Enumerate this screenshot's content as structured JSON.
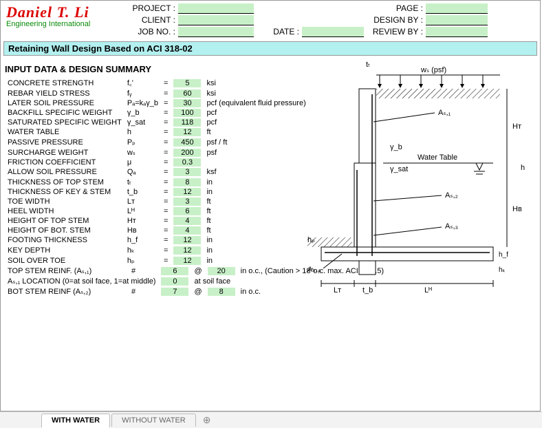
{
  "logo": {
    "name": "Daniel T. Li",
    "sub": "Engineering International"
  },
  "header": {
    "project_l": "PROJECT :",
    "client_l": "CLIENT :",
    "jobno_l": "JOB NO. :",
    "date_l": "DATE :",
    "page_l": "PAGE :",
    "design_l": "DESIGN BY :",
    "review_l": "REVIEW BY :"
  },
  "title": "Retaining Wall Design Based on ACI 318-02",
  "section": "INPUT DATA & DESIGN SUMMARY",
  "rows": [
    {
      "l": "CONCRETE STRENGTH",
      "s": "f꜀'",
      "v": "5",
      "u": "ksi"
    },
    {
      "l": "REBAR YIELD STRESS",
      "s": "fᵧ",
      "v": "60",
      "u": "ksi"
    },
    {
      "l": "LATER SOIL PRESSURE",
      "s": "Pₐ=kₐγ_b",
      "v": "30",
      "u": "pcf (equivalent fluid pressure)"
    },
    {
      "l": "BACKFILL SPECIFIC WEIGHT",
      "s": "γ_b",
      "v": "100",
      "u": "pcf"
    },
    {
      "l": "SATURATED SPECIFIC WEIGHT",
      "s": "γ_sat",
      "v": "118",
      "u": "pcf"
    },
    {
      "l": "WATER TABLE",
      "s": "h",
      "v": "12",
      "u": "ft"
    },
    {
      "l": "PASSIVE PRESSURE",
      "s": "Pₚ",
      "v": "450",
      "u": "psf / ft"
    },
    {
      "l": "SURCHARGE WEIGHT",
      "s": "wₛ",
      "v": "200",
      "u": "psf"
    },
    {
      "l": "FRICTION COEFFICIENT",
      "s": "μ",
      "v": "0.3",
      "u": ""
    },
    {
      "l": "ALLOW SOIL PRESSURE",
      "s": "Qₐ",
      "v": "3",
      "u": "ksf"
    },
    {
      "l": "THICKNESS OF TOP STEM",
      "s": "tₜ",
      "v": "8",
      "u": "in"
    },
    {
      "l": "THICKNESS OF KEY & STEM",
      "s": "t_b",
      "v": "12",
      "u": "in"
    },
    {
      "l": "TOE WIDTH",
      "s": "Lᴛ",
      "v": "3",
      "u": "ft"
    },
    {
      "l": "HEEL WIDTH",
      "s": "Lᴴ",
      "v": "6",
      "u": "ft"
    },
    {
      "l": "HEIGHT OF TOP STEM",
      "s": "Hᴛ",
      "v": "4",
      "u": "ft"
    },
    {
      "l": "HEIGHT OF BOT. STEM",
      "s": "Hʙ",
      "v": "4",
      "u": "ft"
    },
    {
      "l": "FOOTING THICKNESS",
      "s": "h_f",
      "v": "12",
      "u": "in"
    },
    {
      "l": "KEY DEPTH",
      "s": "hₖ",
      "v": "12",
      "u": "in"
    },
    {
      "l": "SOIL OVER TOE",
      "s": "hₚ",
      "v": "12",
      "u": "in"
    }
  ],
  "reinf": {
    "l1": "TOP STEM REINF. (Aₛ,₁)",
    "hash": "#",
    "v1": "6",
    "at": "@",
    "v2": "20",
    "u": "in o.c., (Caution > 18\"o.c. max. ACI 14.3.5)",
    "l2": "Aₛ,₁ LOCATION (0=at soil face, 1=at middle)",
    "v3": "0",
    "u2": "at soil face",
    "l3": "BOT STEM REINF (Aₛ,₂)",
    "v4": "7",
    "v5": "8",
    "u3": "in o.c."
  },
  "diagram": {
    "tt": "tₜ",
    "ws": "wₛ (psf)",
    "as1": "Aₛ,₁",
    "gb": "γ_b",
    "gsat": "γ_sat",
    "wt": "Water Table",
    "as2": "Aₛ,₂",
    "as3": "Aₛ,₃",
    "as4": "Aₛ,₄",
    "ht": "Hᴛ",
    "hb": "Hʙ",
    "hf": "h_f",
    "hk": "hₖ",
    "lt": "Lᴛ",
    "tb": "t_b",
    "lh": "Lᴴ",
    "hp": "hₚ",
    "h": "h"
  },
  "tabs": {
    "active": "WITH WATER",
    "other": "WITHOUT WATER"
  }
}
